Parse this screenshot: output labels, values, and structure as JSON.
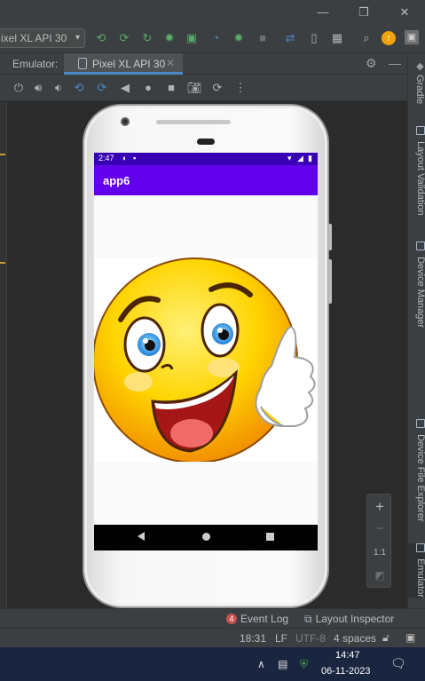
{
  "toolbar": {
    "device_select": "ixel XL API 30",
    "caret": "▾"
  },
  "emulator": {
    "title": "Emulator:",
    "tab_label": "Pixel XL API 30",
    "tab_close": "✕"
  },
  "right_tools": [
    "Gradle",
    "Layout Validation",
    "Device Manager",
    "Device File Explorer",
    "Emulator"
  ],
  "phone": {
    "status_time": "2:47",
    "app_title": "app6"
  },
  "zoom": {
    "zoom_in": "+",
    "zoom_out": "−",
    "actual_size": "1:1"
  },
  "bottom_tools": {
    "event_log": "Event Log",
    "event_log_count": "4",
    "layout_inspector": "Layout Inspector"
  },
  "status_bar": {
    "position": "18:31",
    "line_sep": "LF",
    "encoding": "UTF-8",
    "indent": "4 spaces"
  },
  "taskbar": {
    "time": "14:47",
    "date": "06-11-2023"
  },
  "colors": {
    "status_bar": "#3700b3",
    "app_bar": "#6200ee",
    "accent_tab": "#4a88c7",
    "event_badge": "#c75450"
  }
}
